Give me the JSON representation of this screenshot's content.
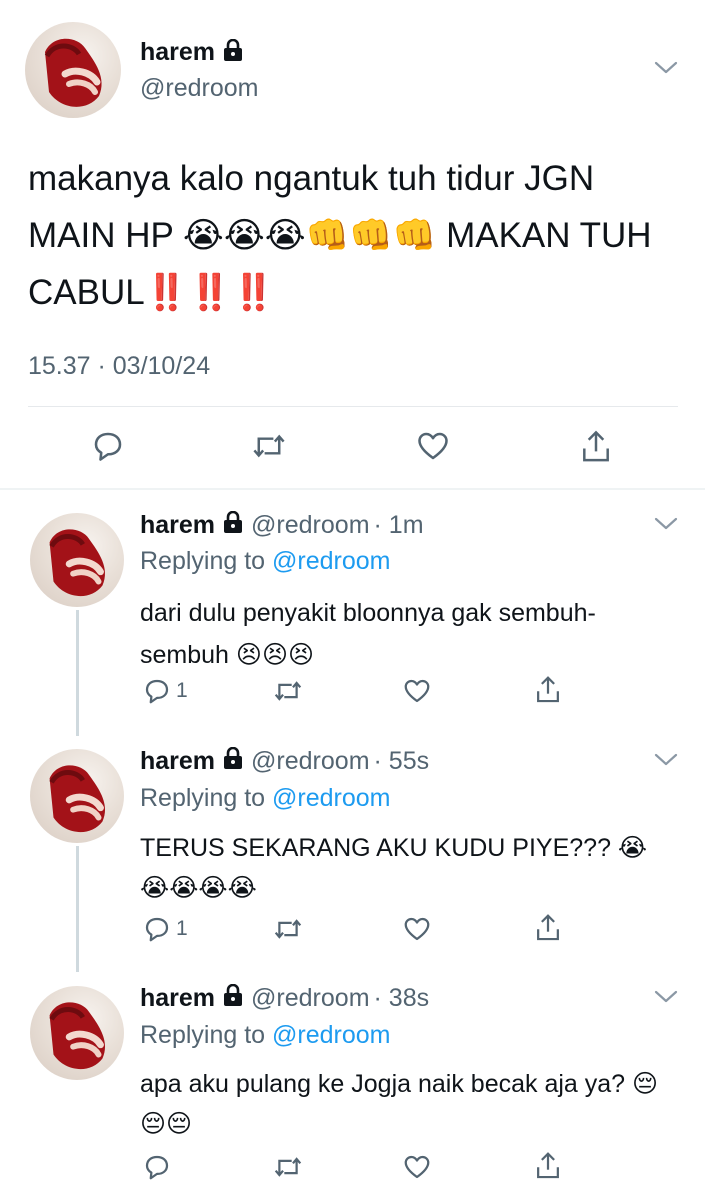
{
  "main_tweet": {
    "name": "harem",
    "handle": "@redroom",
    "text": "makanya kalo ngantuk tuh tidur JGN MAIN HP 😭😭😭👊👊👊 MAKAN TUH CABUL‼️‼️‼️",
    "timestamp": "15.37 · 03/10/24"
  },
  "replies": [
    {
      "name": "harem",
      "handle": "@redroom",
      "time": "· 1m",
      "replying_prefix": "Replying to",
      "replying_handle": "@redroom",
      "text": "dari dulu penyakit bloonnya gak sembuh-sembuh 😣😣😣",
      "reply_count": "1"
    },
    {
      "name": "harem",
      "handle": "@redroom",
      "time": "· 55s",
      "replying_prefix": "Replying to",
      "replying_handle": "@redroom",
      "text": "TERUS SEKARANG AKU KUDU PIYE??? 😭😭😭😭😭",
      "reply_count": "1"
    },
    {
      "name": "harem",
      "handle": "@redroom",
      "time": "· 38s",
      "replying_prefix": "Replying to",
      "replying_handle": "@redroom",
      "text": "apa aku pulang ke Jogja naik becak aja ya? 😔😔😔",
      "reply_count": ""
    }
  ],
  "icons": {
    "lock": "lock-icon",
    "chevron": "chevron-down-icon",
    "reply": "reply-icon",
    "retweet": "retweet-icon",
    "like": "heart-icon",
    "share": "share-icon"
  },
  "colors": {
    "link": "#1d9bf0",
    "muted": "#536471",
    "text": "#0f1419",
    "thread_line": "#cfd9de"
  }
}
